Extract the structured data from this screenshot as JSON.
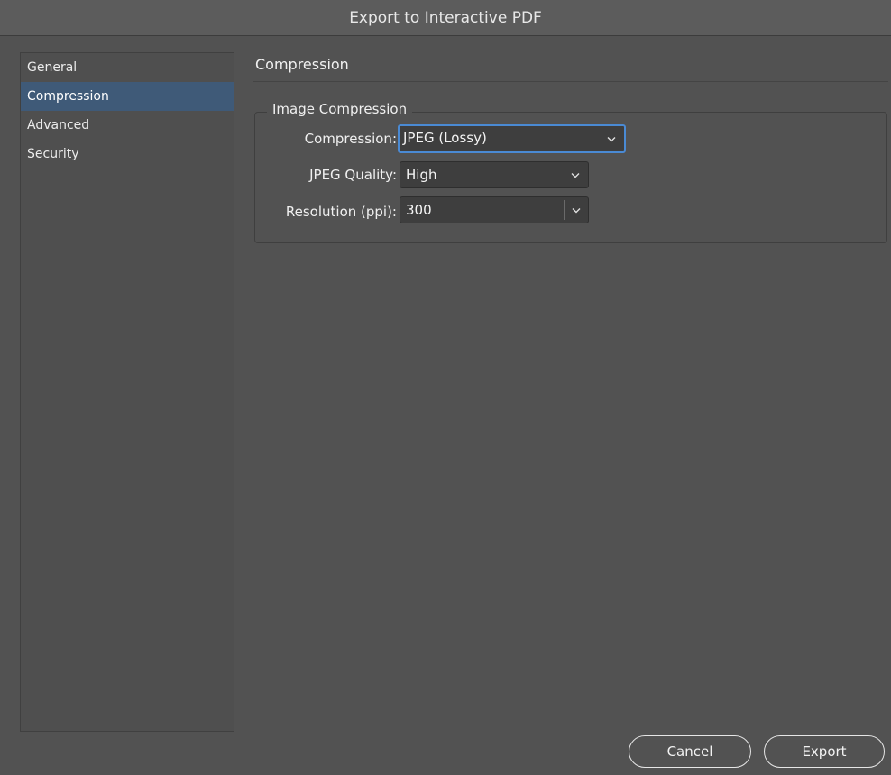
{
  "window": {
    "title": "Export to Interactive PDF"
  },
  "sidebar": {
    "items": [
      {
        "label": "General",
        "active": false
      },
      {
        "label": "Compression",
        "active": true
      },
      {
        "label": "Advanced",
        "active": false
      },
      {
        "label": "Security",
        "active": false
      }
    ]
  },
  "main": {
    "section_title": "Compression",
    "group_title": "Image Compression",
    "compression": {
      "label": "Compression:",
      "value": "JPEG (Lossy)"
    },
    "jpeg_quality": {
      "label": "JPEG Quality:",
      "value": "High"
    },
    "resolution": {
      "label": "Resolution (ppi):",
      "value": "300"
    }
  },
  "footer": {
    "cancel_label": "Cancel",
    "export_label": "Export"
  },
  "colors": {
    "accent": "#4a8ad4",
    "selected_item": "#3f5a78",
    "background": "#525252"
  }
}
